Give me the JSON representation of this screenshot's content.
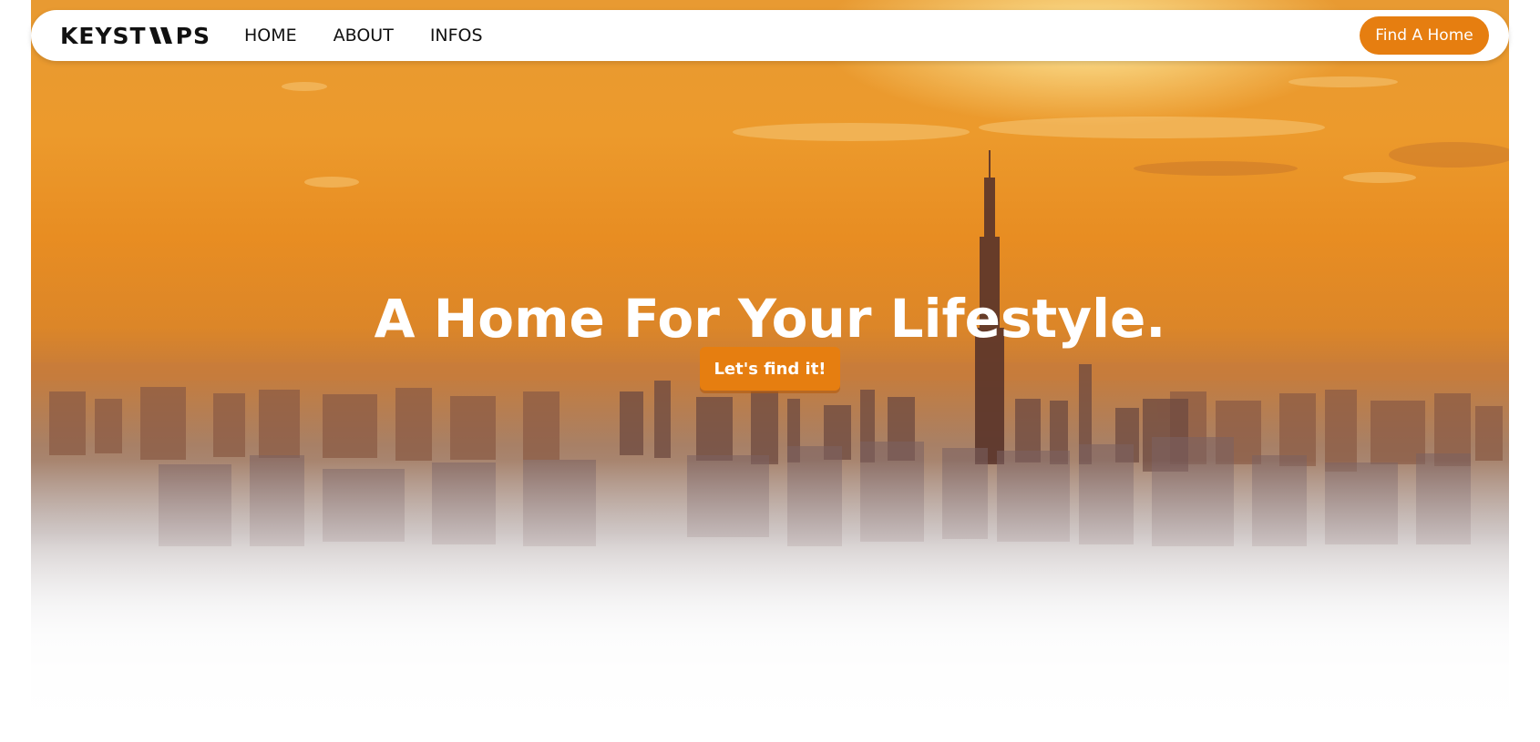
{
  "brand": {
    "logo_left": "KEYST",
    "logo_right": "PS",
    "logo_full": "KEYSTOPS"
  },
  "nav": {
    "items": [
      {
        "label": "HOME"
      },
      {
        "label": "ABOUT"
      },
      {
        "label": "INFOS"
      }
    ],
    "cta_label": "Find A Home"
  },
  "hero": {
    "headline": "A Home For Your Lifestyle.",
    "button_label": "Let's find it!",
    "background": "sunset city skyline fading to white"
  },
  "colors": {
    "accent": "#e67e10",
    "nav_background": "#ffffff",
    "text_dark": "#111111",
    "text_light": "#ffffff"
  },
  "icons": {
    "logo_mark": "footsteps-icon"
  }
}
